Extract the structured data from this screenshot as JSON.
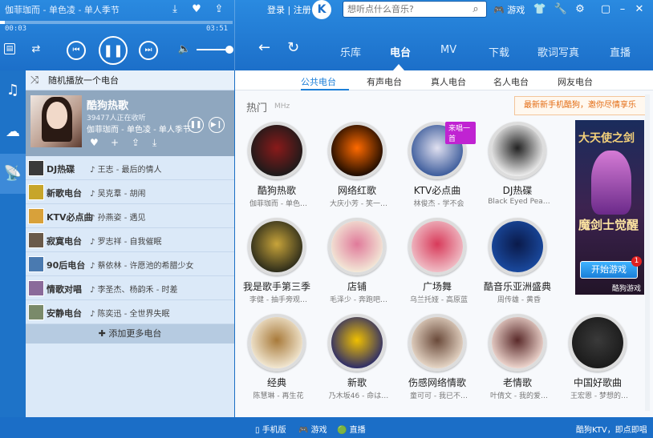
{
  "player": {
    "now_playing": "伽菲珈而 - 单色凌 - 单人季节",
    "time_elapsed": "00:03",
    "time_total": "03:51",
    "progress_percent": 2,
    "volume_percent": 90
  },
  "header": {
    "login_label": "登录",
    "register_label": "注册",
    "separator": "|",
    "logo_letter": "K",
    "search_placeholder": "想听点什么音乐?",
    "game_label": "游戏"
  },
  "nav": {
    "tabs": [
      "乐库",
      "电台",
      "MV",
      "下载",
      "歌词写真",
      "直播"
    ],
    "active": "电台"
  },
  "sidebar": {
    "random_label": "随机播放一个电台",
    "current": {
      "name": "酷狗热歌",
      "listeners": "39477人正在收听",
      "track": "伽菲珈而 - 单色凌 - 单人季节"
    },
    "stations": [
      {
        "name": "DJ热碟",
        "now": "王志 - 最后的情人",
        "color": "#3a3a3a"
      },
      {
        "name": "新歌电台",
        "now": "吴克羣 - 胡闹",
        "color": "#c7a52a"
      },
      {
        "name": "KTV必点曲",
        "now": "孙燕姿 - 遇见",
        "color": "#d8a13a"
      },
      {
        "name": "寂寞电台",
        "now": "罗志祥 - 自我催眠",
        "color": "#6a5a4a"
      },
      {
        "name": "90后电台",
        "now": "蔡依林 - 许愿池的希腊少女",
        "color": "#4a7ab0"
      },
      {
        "name": "情歌对唱",
        "now": "李圣杰、杨韵禾 - 时差",
        "color": "#8a6a9a"
      },
      {
        "name": "安静电台",
        "now": "陈奕迅 - 全世界失眠",
        "color": "#7a8a6a"
      }
    ],
    "add_more_label": "添加更多电台"
  },
  "main": {
    "subtabs": [
      "公共电台",
      "有声电台",
      "真人电台",
      "名人电台",
      "网友电台"
    ],
    "active_subtab": "公共电台",
    "section_title": "热门",
    "section_unit": "MHz",
    "promo": "最新新手机酷狗，邀你尽情享乐",
    "cards": [
      {
        "label": "酷狗热歌",
        "sub": "伽菲珈而 - 单色…",
        "c1": "#1a1a1a",
        "c2": "#8a1a1a"
      },
      {
        "label": "网络红歌",
        "sub": "大庆小芳 - 笑一…",
        "c1": "#1a0a00",
        "c2": "#ff6a00"
      },
      {
        "label": "KTV必点曲",
        "sub": "林俊杰 - 学不会",
        "c1": "#3a5a9a",
        "c2": "#e0e0f0",
        "badge": "来唱一首"
      },
      {
        "label": "DJ热碟",
        "sub": "Black Eyed Pea…",
        "c1": "#f0f0f0",
        "c2": "#222222"
      },
      {
        "label": "我是歌手第三季",
        "sub": "李健 - 抽手旁观…",
        "c1": "#2a2a1a",
        "c2": "#c8a43a"
      },
      {
        "label": "店铺",
        "sub": "毛泽少 - 奔跑吧…",
        "c1": "#f3ead8",
        "c2": "#e07a9a"
      },
      {
        "label": "广场舞",
        "sub": "乌兰托娅 - 高原蓝",
        "c1": "#f0c0c8",
        "c2": "#d83a5a"
      },
      {
        "label": "酷音乐亚洲盛典",
        "sub": "周传雄 - 黄昏",
        "c1": "#1a4aa0",
        "c2": "#0a1a4a"
      },
      {
        "label": "经典",
        "sub": "陈慧琳 - 再生花",
        "c1": "#f3e9d4",
        "c2": "#a87a3a"
      },
      {
        "label": "新歌",
        "sub": "乃木坂46 - 命は…",
        "c1": "#2a2a6a",
        "c2": "#f0c000"
      },
      {
        "label": "伤感网络情歌",
        "sub": "童可可 - 我已不…",
        "c1": "#e8d8c8",
        "c2": "#6a4a3a"
      },
      {
        "label": "老情歌",
        "sub": "叶倩文 - 我的爱…",
        "c1": "#f0d8d0",
        "c2": "#5a2a2a"
      },
      {
        "label": "中国好歌曲",
        "sub": "王宏恩 - 梦想的…",
        "c1": "#1a1a1a",
        "c2": "#3a3a3a"
      }
    ],
    "ad": {
      "title": "大天使之剑",
      "subtitle": "魔剑士觉醒",
      "button": "开始游戏",
      "footer": "酷狗游戏",
      "badge": "1"
    }
  },
  "statusbar": {
    "mobile": "手机版",
    "game": "游戏",
    "live": "直播",
    "ktv": "酷狗KTV，即点即唱"
  },
  "colors": {
    "brand_blue": "#1c6fc9",
    "accent_blue": "#1c7fd8",
    "promo_orange": "#e36b12"
  }
}
